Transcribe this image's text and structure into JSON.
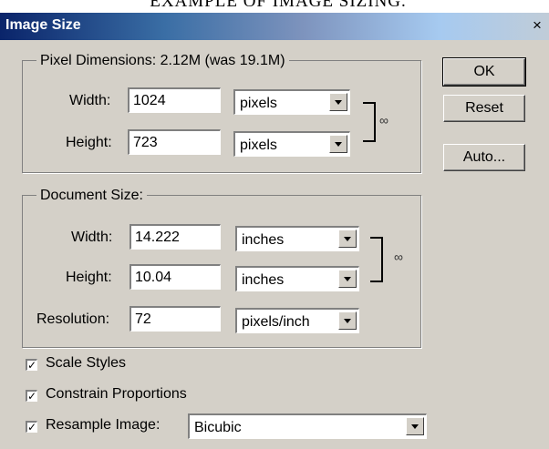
{
  "caption": "EXAMPLE OF IMAGE SIZING.",
  "window": {
    "title": "Image Size",
    "close_glyph": "×"
  },
  "pixel_dimensions": {
    "legend": "Pixel Dimensions: 2.12M (was 19.1M)",
    "width": {
      "label": "Width:",
      "value": "1024",
      "unit": "pixels"
    },
    "height": {
      "label": "Height:",
      "value": "723",
      "unit": "pixels"
    }
  },
  "document_size": {
    "legend": "Document Size:",
    "width": {
      "label": "Width:",
      "value": "14.222",
      "unit": "inches"
    },
    "height": {
      "label": "Height:",
      "value": "10.04",
      "unit": "inches"
    },
    "resolution": {
      "label": "Resolution:",
      "value": "72",
      "unit": "pixels/inch"
    }
  },
  "buttons": {
    "ok": "OK",
    "reset": "Reset",
    "auto": "Auto..."
  },
  "options": {
    "scale_styles": {
      "label": "Scale Styles",
      "checked": true
    },
    "constrain_proportions": {
      "label": "Constrain Proportions",
      "checked": true
    },
    "resample_image": {
      "label": "Resample Image:",
      "checked": true,
      "method": "Bicubic"
    }
  },
  "icons": {
    "check": "✓",
    "link": "link-chain-icon"
  }
}
